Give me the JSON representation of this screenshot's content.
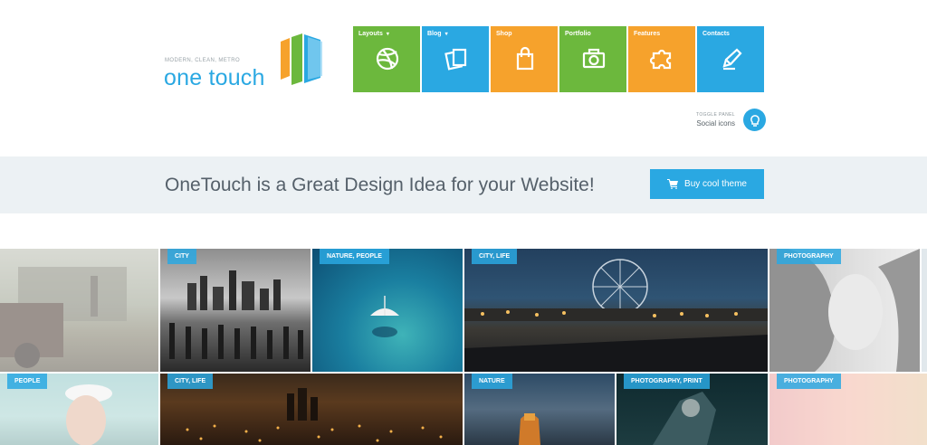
{
  "logo": {
    "tagline": "MODERN, CLEAN, METRO",
    "name": "one touch"
  },
  "menu": [
    {
      "label": "Layouts",
      "caret": "▾",
      "color": "#6cb83d",
      "icon": "dribbble-icon"
    },
    {
      "label": "Blog",
      "caret": "▾",
      "color": "#2aa8e2",
      "icon": "pages-icon"
    },
    {
      "label": "Shop",
      "caret": "",
      "color": "#f6a22c",
      "icon": "shopping-bag-icon"
    },
    {
      "label": "Portfolio",
      "caret": "",
      "color": "#6cb83d",
      "icon": "camera-icon"
    },
    {
      "label": "Features",
      "caret": "",
      "color": "#f6a22c",
      "icon": "puzzle-icon"
    },
    {
      "label": "Contacts",
      "caret": "",
      "color": "#2aa8e2",
      "icon": "pen-icon"
    }
  ],
  "toggle_panel": {
    "small": "TOGGLE PANEL",
    "main": "Social icons"
  },
  "banner": {
    "text": "OneTouch is a Great Design Idea for your Website!",
    "button": "Buy cool theme"
  },
  "gallery": [
    {
      "tag": ""
    },
    {
      "tag": "CITY"
    },
    {
      "tag": "NATURE, PEOPLE"
    },
    {
      "tag": "CITY, LIFE"
    },
    {
      "tag": "PHOTOGRAPHY"
    },
    {
      "tag": "PEOPLE"
    },
    {
      "tag": "CITY, LIFE"
    },
    {
      "tag": "NATURE"
    },
    {
      "tag": "PHOTOGRAPHY, PRINT"
    },
    {
      "tag": "PHOTOGRAPHY"
    }
  ],
  "colors": {
    "accent": "#2aa8e2",
    "green": "#6cb83d",
    "orange": "#f6a22c",
    "banner_bg": "#ecf1f4"
  }
}
